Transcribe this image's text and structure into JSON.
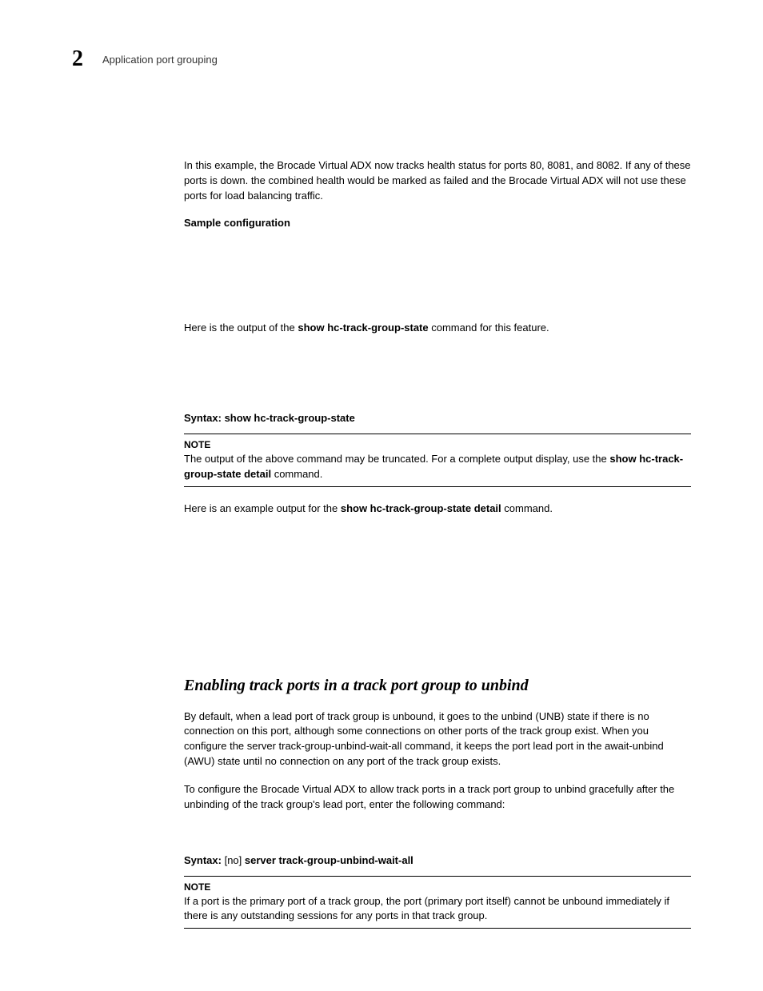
{
  "header": {
    "chapter_number": "2",
    "title": "Application port grouping"
  },
  "intro_para": "In this example, the Brocade Virtual ADX now tracks health status for ports 80, 8081, and 8082. If any of these ports is down. the combined health would be marked as failed and the Brocade Virtual ADX will not use these ports for load balancing traffic.",
  "sample_config_heading": "Sample configuration",
  "output_para_prefix": "Here is the output of the ",
  "output_para_bold": "show hc-track-group-state",
  "output_para_suffix": " command for this feature.",
  "syntax1_label": "Syntax:  ",
  "syntax1_cmd": "show hc-track-group-state",
  "note1": {
    "label": "NOTE",
    "text_prefix": "The output of the above command may be truncated. For a complete output display, use the ",
    "text_bold1": "show hc-track-group-state detail",
    "text_suffix": " command."
  },
  "example_output_prefix": "Here is an example output for the ",
  "example_output_bold": "show hc-track-group-state detail",
  "example_output_suffix": " command.",
  "section_heading": "Enabling track ports in a track port group to unbind",
  "section_para1": "By default, when a lead port of track group is unbound, it goes to the unbind (UNB) state if there is no connection on this port, although some connections on other ports of the track group exist. When you configure the server track-group-unbind-wait-all command, it keeps the port lead port in the await-unbind (AWU) state until no connection on any port of the track group exists.",
  "section_para2": "To configure the Brocade Virtual ADX to allow track ports in a track port group to unbind gracefully after the unbinding of the track group's lead port, enter the following command:",
  "syntax2_label": "Syntax:  ",
  "syntax2_opt": "[no] ",
  "syntax2_cmd": "server track-group-unbind-wait-all",
  "note2": {
    "label": "NOTE",
    "text": "If a port is the primary port of a track group, the port (primary port itself) cannot be unbound immediately if there is any outstanding sessions for any ports in that track group."
  }
}
